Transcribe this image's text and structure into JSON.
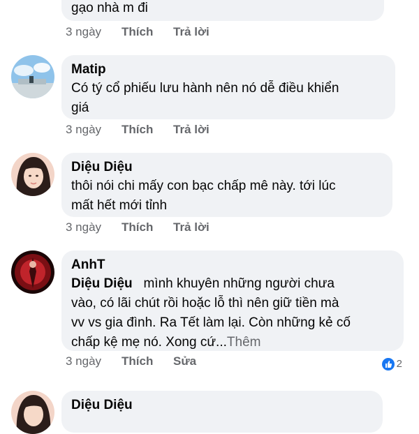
{
  "comments": [
    {
      "text_lines": [
        "gạo nhà m đi"
      ],
      "time": "3 ngày",
      "like": "Thích",
      "reply": "Trả lời"
    },
    {
      "author": "Matip",
      "text_lines": [
        "Có tý cổ phiếu lưu hành nên nó dễ điều khiển",
        "giá"
      ],
      "time": "3 ngày",
      "like": "Thích",
      "reply": "Trả lời"
    },
    {
      "author": "Diệu Diệu",
      "text_lines": [
        "thôi nói chi mấy con bạc chấp mê này. tới lúc",
        "mất hết mới tỉnh"
      ],
      "time": "3 ngày",
      "like": "Thích",
      "reply": "Trả lời"
    },
    {
      "author": "AnhT",
      "mention": "Diệu Diệu",
      "text_first": "mình khuyên những người chưa",
      "text_lines": [
        "vào, có lãi chút rồi hoặc lỗ thì nên giữ tiền mà",
        "vv vs gia đình. Ra Tết làm lại. Còn những kẻ cố"
      ],
      "text_last": "chấp kệ mẹ nó. Xong cứ...",
      "see_more": "Thêm",
      "time": "3 ngày",
      "like": "Thích",
      "reply": "Sửa",
      "reaction_count": "2",
      "reaction_icon": "thumbs-up-icon"
    },
    {
      "author": "Diệu Diệu"
    }
  ],
  "colors": {
    "bubble": "#f0f2f5",
    "muted": "#65676b",
    "reaction": "#1877f2"
  }
}
